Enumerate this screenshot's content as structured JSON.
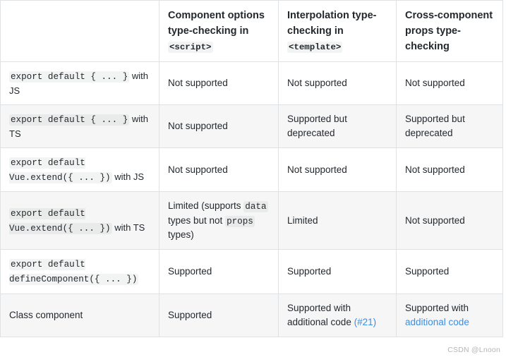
{
  "table": {
    "headers": [
      {
        "text": "",
        "code": ""
      },
      {
        "text": "Component options type-checking in",
        "code": "<script>"
      },
      {
        "text": "Interpolation type-checking in",
        "code": "<template>"
      },
      {
        "text": "Cross-component props type-checking",
        "code": ""
      }
    ],
    "rows": [
      {
        "label_code": "export default { ... }",
        "label_tail": " with JS",
        "col2": "Not supported",
        "col3": "Not supported",
        "col4": "Not supported"
      },
      {
        "label_code": "export default { ... }",
        "label_tail": " with TS",
        "col2": "Not supported",
        "col3": "Supported but deprecated",
        "col4": "Supported but deprecated"
      },
      {
        "label_code": "export default Vue.extend({ ... })",
        "label_tail": " with JS",
        "col2": "Not supported",
        "col3": "Not supported",
        "col4": "Not supported"
      },
      {
        "label_code": "export default Vue.extend({ ... })",
        "label_tail": " with TS",
        "col2_pre": "Limited (supports ",
        "col2_code1": "data",
        "col2_mid": " types but not ",
        "col2_code2": "props",
        "col2_post": " types)",
        "col3": "Limited",
        "col4": "Not supported"
      },
      {
        "label_code": "export default defineComponent({ ... })",
        "label_tail": "",
        "col2": "Supported",
        "col3": "Supported",
        "col4": "Supported"
      },
      {
        "label_plain": "Class component",
        "col2": "Supported",
        "col3_pre": "Supported with additional code ",
        "col3_link": "(#21)",
        "col4_pre": "Supported with ",
        "col4_link": "additional code"
      }
    ]
  },
  "watermark": "CSDN @Lnoon",
  "colors": {
    "link": "#3a8ee6",
    "border": "#dfe2e5",
    "stripe": "#f6f6f6",
    "code_bg": "rgba(27,31,35,0.055)",
    "text": "#24292e",
    "watermark": "#b5b5b5"
  }
}
